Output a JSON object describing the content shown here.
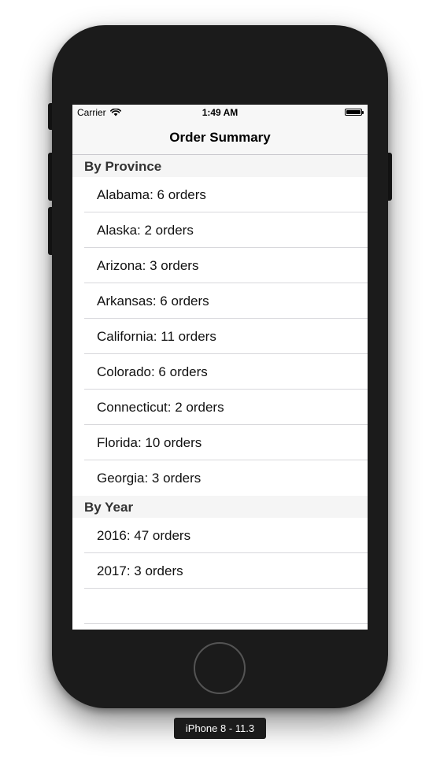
{
  "status_bar": {
    "carrier": "Carrier",
    "time": "1:49 AM",
    "wifi_icon": "wifi-icon",
    "battery_icon": "battery-icon"
  },
  "nav": {
    "title": "Order Summary"
  },
  "sections": [
    {
      "header": "By Province",
      "rows": [
        "Alabama: 6 orders",
        "Alaska: 2 orders",
        "Arizona: 3 orders",
        "Arkansas: 6 orders",
        "California: 11 orders",
        "Colorado: 6 orders",
        "Connecticut: 2 orders",
        "Florida: 10 orders",
        "Georgia: 3 orders"
      ]
    },
    {
      "header": "By Year",
      "rows": [
        "2016: 47 orders",
        "2017: 3 orders"
      ]
    }
  ],
  "device_label": "iPhone 8 - 11.3",
  "colors": {
    "device_body": "#1b1b1b",
    "bar_background": "#f7f7f7",
    "section_header_bg": "#f5f5f5",
    "separator": "#d8d8dc"
  }
}
